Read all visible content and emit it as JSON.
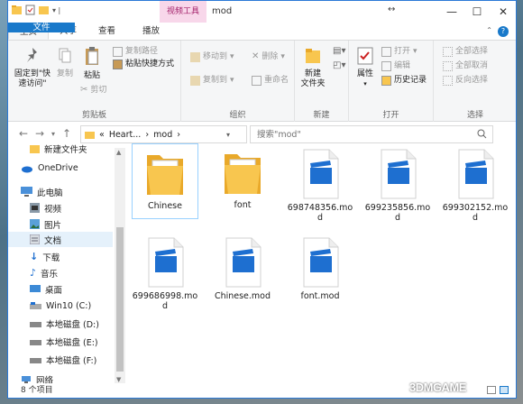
{
  "window": {
    "title": "mod",
    "context_tab": "视频工具",
    "controls": {
      "minimize": "—",
      "maximize": "☐",
      "close": "✕"
    }
  },
  "tabs": [
    {
      "label": "文件"
    },
    {
      "label": "主页"
    },
    {
      "label": "共享"
    },
    {
      "label": "查看"
    },
    {
      "label": "播放"
    }
  ],
  "ribbon": {
    "clipboard": {
      "label": "剪贴板",
      "pin_label": "固定到\"快速访问\"",
      "copy_label": "复制",
      "paste_label": "粘贴",
      "copy_path_label": "复制路径",
      "paste_shortcut_label": "粘贴快捷方式",
      "cut_label": "剪切"
    },
    "organize": {
      "label": "组织",
      "move_to_label": "移动到",
      "copy_to_label": "复制到",
      "delete_label": "删除",
      "rename_label": "重命名"
    },
    "new": {
      "label": "新建",
      "new_folder_label": "新建\n文件夹"
    },
    "open": {
      "label": "打开",
      "properties_label": "属性",
      "open_label": "打开",
      "edit_label": "编辑",
      "history_label": "历史记录"
    },
    "select": {
      "label": "选择",
      "select_all_label": "全部选择",
      "select_none_label": "全部取消",
      "invert_label": "反向选择"
    }
  },
  "address": {
    "crumbs": [
      "«",
      "Heart...",
      "›",
      "mod",
      "›"
    ],
    "search_placeholder": "搜索\"mod\""
  },
  "sidebar": {
    "items": [
      {
        "label": "新建文件夹",
        "icon": "folder-icon"
      },
      {
        "label": "OneDrive",
        "icon": "cloud-icon"
      },
      {
        "label": "此电脑",
        "icon": "computer-icon"
      },
      {
        "label": "视频",
        "icon": "video-folder-icon"
      },
      {
        "label": "图片",
        "icon": "pictures-folder-icon"
      },
      {
        "label": "文档",
        "icon": "documents-folder-icon"
      },
      {
        "label": "下载",
        "icon": "download-icon"
      },
      {
        "label": "音乐",
        "icon": "music-icon"
      },
      {
        "label": "桌面",
        "icon": "desktop-icon"
      },
      {
        "label": "Win10 (C:)",
        "icon": "drive-c-icon"
      },
      {
        "label": "本地磁盘 (D:)",
        "icon": "drive-icon"
      },
      {
        "label": "本地磁盘 (E:)",
        "icon": "drive-icon"
      },
      {
        "label": "本地磁盘 (F:)",
        "icon": "drive-icon"
      },
      {
        "label": "网络",
        "icon": "network-icon"
      }
    ]
  },
  "files": [
    {
      "name": "Chinese",
      "type": "folder"
    },
    {
      "name": "font",
      "type": "folder"
    },
    {
      "name": "698748356.mod",
      "line1": "698748356.mo",
      "line2": "d",
      "type": "video"
    },
    {
      "name": "699235856.mod",
      "line1": "699235856.mo",
      "line2": "d",
      "type": "video"
    },
    {
      "name": "699302152.mod",
      "line1": "699302152.mo",
      "line2": "d",
      "type": "video"
    },
    {
      "name": "699686998.mod",
      "line1": "699686998.mo",
      "line2": "d",
      "type": "video"
    },
    {
      "name": "Chinese.mod",
      "line1": "Chinese.mod",
      "line2": "",
      "type": "video"
    },
    {
      "name": "font.mod",
      "line1": "font.mod",
      "line2": "",
      "type": "video"
    }
  ],
  "status": {
    "count": "8 个项目"
  },
  "watermark": "3DMGAME",
  "colors": {
    "accent": "#1979ca",
    "folder": "#f8c64f",
    "video": "#1e6fd0",
    "context": "#a3206a"
  }
}
